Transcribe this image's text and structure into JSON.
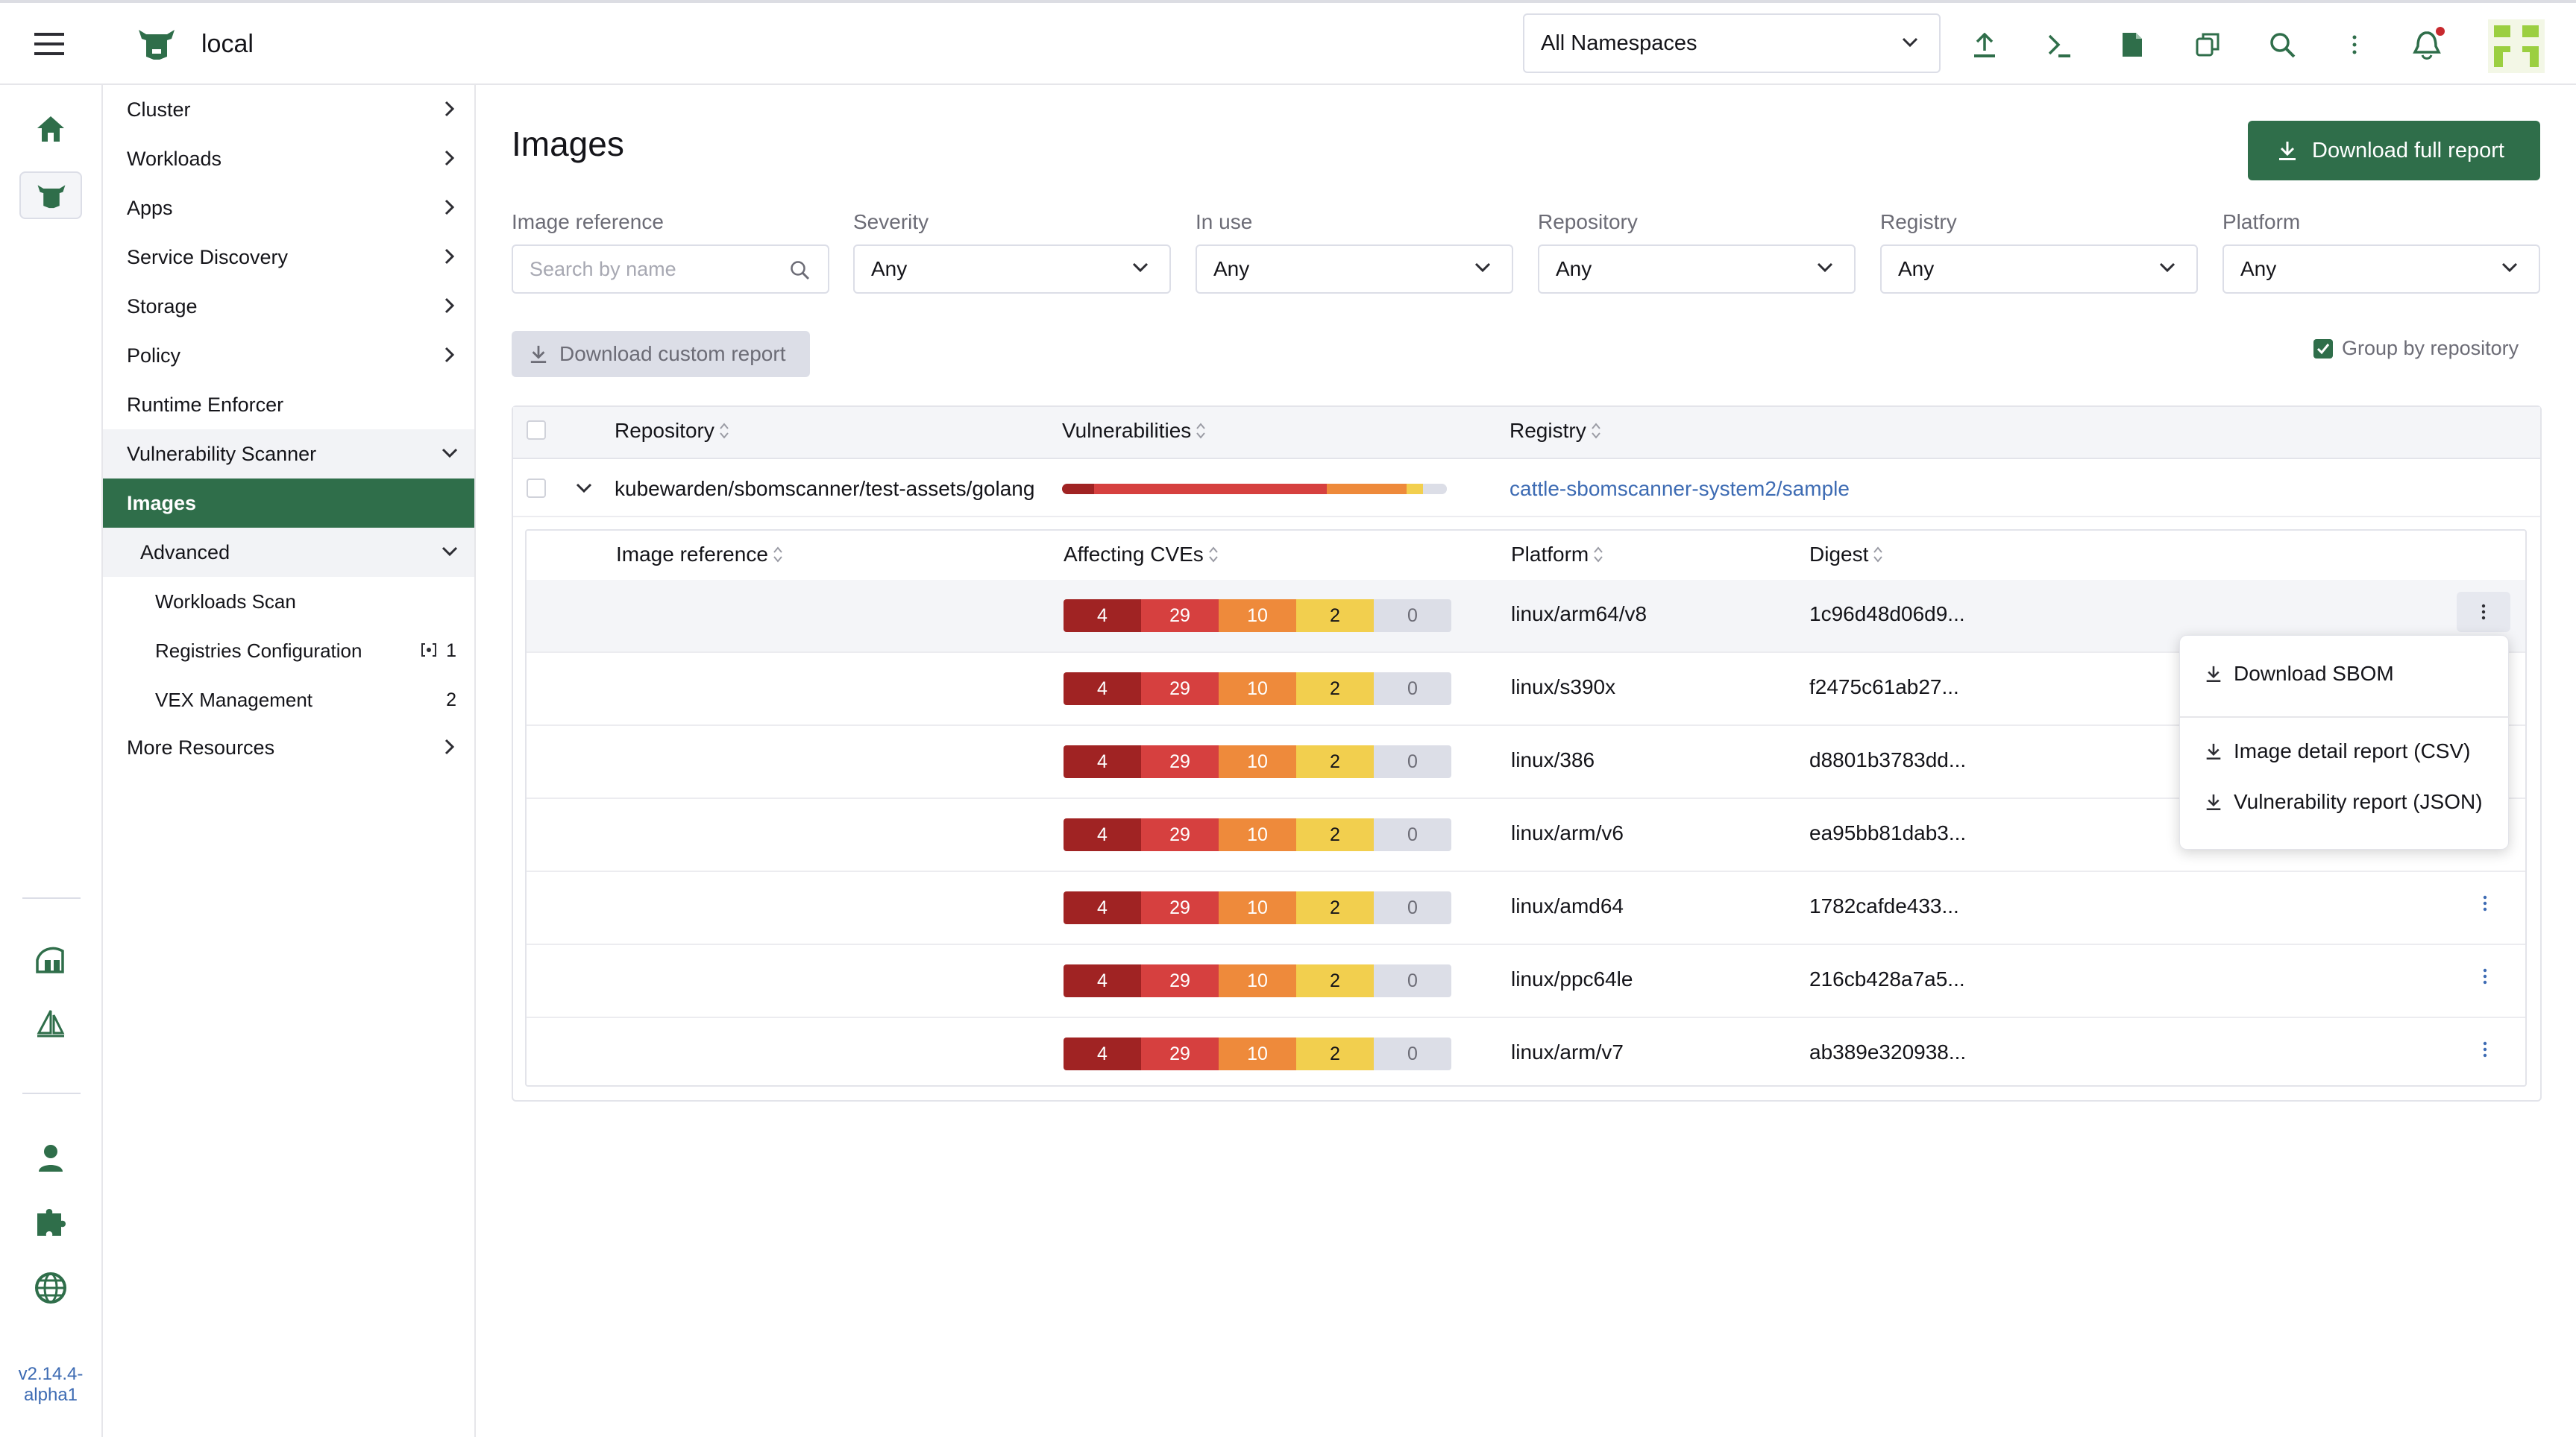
{
  "header": {
    "cluster_name": "local",
    "namespace_select": "All Namespaces",
    "icons": [
      "menu-icon",
      "cow-logo-icon",
      "upload-icon",
      "terminal-icon",
      "file-icon",
      "copy-icon",
      "search-icon",
      "more-vertical-icon",
      "bell-icon",
      "avatar"
    ]
  },
  "rail": {
    "version_line1": "v2.14.4-",
    "version_line2": "alpha1"
  },
  "sidenav": {
    "items": [
      {
        "label": "Cluster"
      },
      {
        "label": "Workloads"
      },
      {
        "label": "Apps"
      },
      {
        "label": "Service Discovery"
      },
      {
        "label": "Storage"
      },
      {
        "label": "Policy"
      },
      {
        "label": "Runtime Enforcer"
      },
      {
        "label": "Vulnerability Scanner"
      },
      {
        "label": "Images"
      },
      {
        "label": "Advanced"
      },
      {
        "label": "Workloads Scan"
      },
      {
        "label": "Registries Configuration",
        "count": "1"
      },
      {
        "label": "VEX Management",
        "count": "2"
      },
      {
        "label": "More Resources"
      }
    ]
  },
  "page": {
    "title": "Images",
    "download_full_report": "Download full report",
    "download_custom_report": "Download custom report",
    "group_by_repository": "Group by repository"
  },
  "filters": {
    "image_reference": {
      "label": "Image reference",
      "placeholder": "Search by name"
    },
    "severity": {
      "label": "Severity",
      "value": "Any"
    },
    "in_use": {
      "label": "In use",
      "value": "Any"
    },
    "repository": {
      "label": "Repository",
      "value": "Any"
    },
    "registry": {
      "label": "Registry",
      "value": "Any"
    },
    "platform": {
      "label": "Platform",
      "value": "Any"
    }
  },
  "table": {
    "headers": {
      "repository": "Repository",
      "vulnerabilities": "Vulnerabilities",
      "registry": "Registry"
    },
    "group": {
      "repository": "kubewarden/sbomscanner/test-assets/golang",
      "registry": "cattle-sbomscanner-system2/sample",
      "vuln_fractions": {
        "critical": 0.083,
        "high": 0.604,
        "medium": 0.208,
        "low": 0.042,
        "unknown": 0.0
      }
    },
    "subheaders": {
      "image_reference": "Image reference",
      "affecting_cves": "Affecting CVEs",
      "platform": "Platform",
      "digest": "Digest"
    },
    "rows": [
      {
        "critical": "4",
        "high": "29",
        "medium": "10",
        "low": "2",
        "unknown": "0",
        "platform": "linux/arm64/v8",
        "digest": "1c96d48d06d9..."
      },
      {
        "critical": "4",
        "high": "29",
        "medium": "10",
        "low": "2",
        "unknown": "0",
        "platform": "linux/s390x",
        "digest": "f2475c61ab27..."
      },
      {
        "critical": "4",
        "high": "29",
        "medium": "10",
        "low": "2",
        "unknown": "0",
        "platform": "linux/386",
        "digest": "d8801b3783dd..."
      },
      {
        "critical": "4",
        "high": "29",
        "medium": "10",
        "low": "2",
        "unknown": "0",
        "platform": "linux/arm/v6",
        "digest": "ea95bb81dab3..."
      },
      {
        "critical": "4",
        "high": "29",
        "medium": "10",
        "low": "2",
        "unknown": "0",
        "platform": "linux/amd64",
        "digest": "1782cafde433..."
      },
      {
        "critical": "4",
        "high": "29",
        "medium": "10",
        "low": "2",
        "unknown": "0",
        "platform": "linux/ppc64le",
        "digest": "216cb428a7a5..."
      },
      {
        "critical": "4",
        "high": "29",
        "medium": "10",
        "low": "2",
        "unknown": "0",
        "platform": "linux/arm/v7",
        "digest": "ab389e320938..."
      }
    ]
  },
  "dropdown_menu": {
    "items": [
      "Download SBOM",
      "Image detail report (CSV)",
      "Vulnerability report (JSON)"
    ]
  },
  "colors": {
    "brand_green": "#2f6e4a",
    "link_blue": "#3d6bb3",
    "critical": "#a02323",
    "high": "#d6403f",
    "medium": "#ee8a3b",
    "low": "#f2cf4e",
    "unknown": "#dcdee7"
  }
}
